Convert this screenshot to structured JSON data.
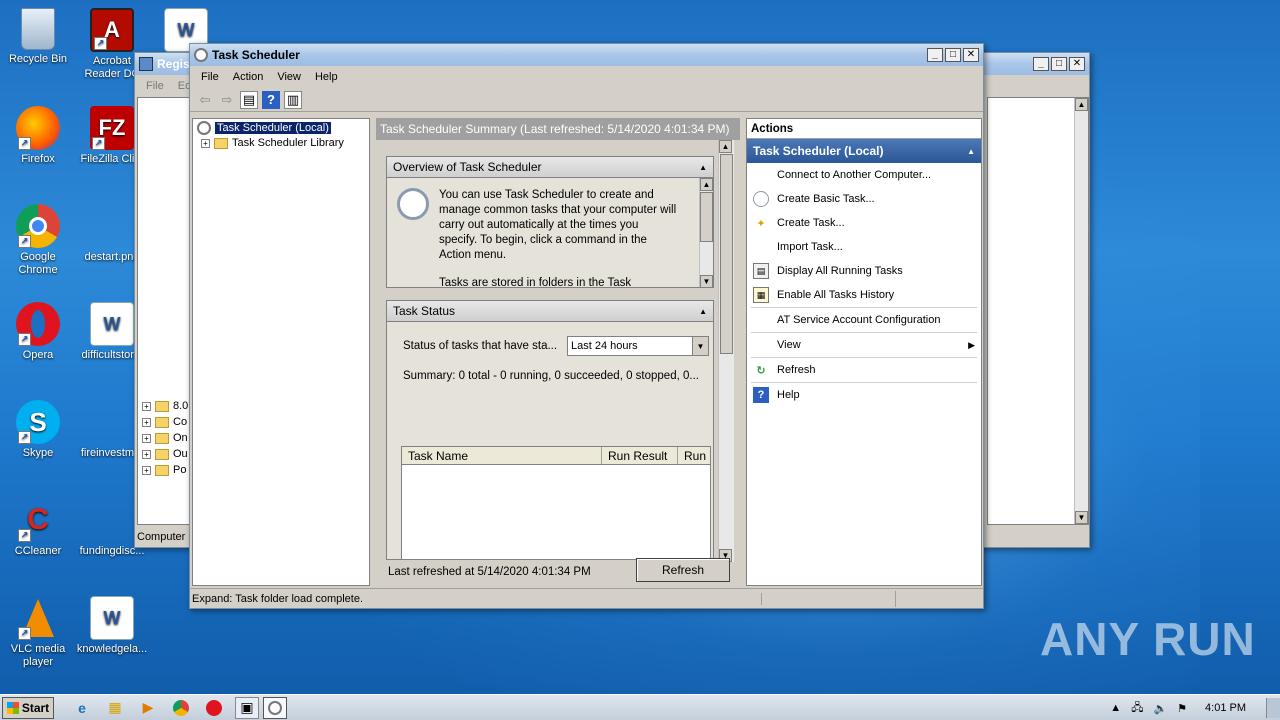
{
  "desktop": {
    "icons": [
      {
        "label": "Recycle Bin",
        "icon": "recycle-bin-icon"
      },
      {
        "label": "Acrobat Reader DC",
        "icon": "acrobat-icon"
      },
      {
        "label": "Firefox",
        "icon": "firefox-icon"
      },
      {
        "label": "FileZilla Cli...",
        "icon": "filezilla-icon"
      },
      {
        "label": "Google Chrome",
        "icon": "chrome-icon"
      },
      {
        "label": "destart.png",
        "icon": "image-file-icon"
      },
      {
        "label": "Opera",
        "icon": "opera-icon"
      },
      {
        "label": "difficultstor...",
        "icon": "word-doc-icon"
      },
      {
        "label": "Skype",
        "icon": "skype-icon"
      },
      {
        "label": "fireinvestm...",
        "icon": "file-icon"
      },
      {
        "label": "CCleaner",
        "icon": "ccleaner-icon"
      },
      {
        "label": "fundingdisc...",
        "icon": "file-icon"
      },
      {
        "label": "VLC media player",
        "icon": "vlc-icon"
      },
      {
        "label": "knowledgela...",
        "icon": "word-doc-icon"
      }
    ],
    "watermark": "ANY RUN"
  },
  "regedit": {
    "title": "Regis",
    "menu": [
      "File",
      "Edi"
    ],
    "tree_items": [
      "8.0",
      "Co",
      "On",
      "Ou",
      "Po"
    ],
    "status": "Computer"
  },
  "task_scheduler": {
    "title": "Task Scheduler",
    "menu": [
      "File",
      "Action",
      "View",
      "Help"
    ],
    "tree": {
      "root": "Task Scheduler (Local)",
      "library": "Task Scheduler Library"
    },
    "summary_header": "Task Scheduler Summary (Last refreshed: 5/14/2020 4:01:34 PM)",
    "overview": {
      "title": "Overview of Task Scheduler",
      "text": "You can use Task Scheduler to create and manage common tasks that your computer will carry out automatically at the times you specify. To begin, click a command in the Action menu.",
      "text2": "Tasks are stored in folders in the Task"
    },
    "task_status": {
      "title": "Task Status",
      "status_label": "Status of tasks that have sta...",
      "select_value": "Last 24 hours",
      "summary": "Summary: 0 total - 0 running, 0 succeeded, 0 stopped, 0...",
      "columns": [
        "Task Name",
        "Run Result",
        "Run S"
      ]
    },
    "footer": {
      "last_refreshed": "Last refreshed at 5/14/2020 4:01:34 PM",
      "refresh_button": "Refresh"
    },
    "actions": {
      "header": "Actions",
      "group": "Task Scheduler (Local)",
      "items": [
        {
          "label": "Connect to Another Computer...",
          "icon": ""
        },
        {
          "label": "Create Basic Task...",
          "icon": "create-basic-task-icon"
        },
        {
          "label": "Create Task...",
          "icon": "create-task-icon"
        },
        {
          "label": "Import Task...",
          "icon": ""
        },
        {
          "label": "Display All Running Tasks",
          "icon": "running-tasks-icon"
        },
        {
          "label": "Enable All Tasks History",
          "icon": "history-icon"
        },
        {
          "label": "AT Service Account Configuration",
          "icon": ""
        },
        {
          "label": "View",
          "icon": ""
        },
        {
          "label": "Refresh",
          "icon": "refresh-icon"
        },
        {
          "label": "Help",
          "icon": "help-icon"
        }
      ]
    },
    "statusbar": "Expand:  Task folder load complete."
  },
  "taskbar": {
    "start": "Start",
    "clock": "4:01 PM"
  }
}
